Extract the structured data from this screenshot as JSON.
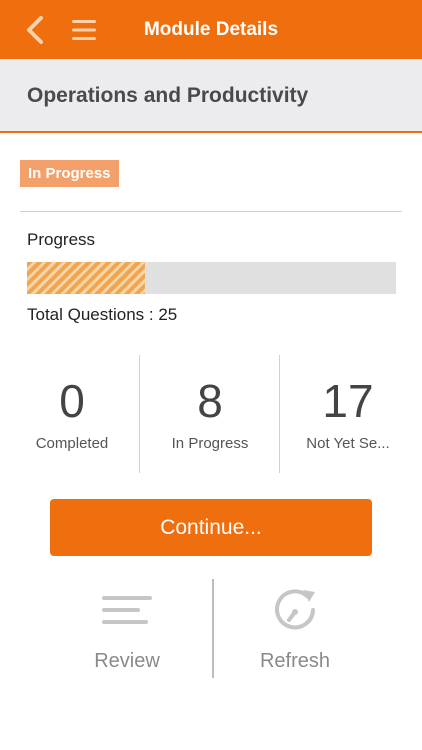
{
  "header": {
    "title": "Module Details",
    "back_icon": "chevron-left-icon",
    "menu_icon": "hamburger-menu-icon",
    "bar_color": "#ef6f0f"
  },
  "module": {
    "title": "Operations and Productivity"
  },
  "status": {
    "label": "In Progress",
    "color": "#f3a06a"
  },
  "progress": {
    "label": "Progress",
    "fraction": 0.32,
    "total_text": "Total Questions : 25"
  },
  "stats": [
    {
      "value": "0",
      "label": "Completed"
    },
    {
      "value": "8",
      "label": "In Progress"
    },
    {
      "value": "17",
      "label": "Not Yet Se..."
    }
  ],
  "actions": {
    "continue_label": "Continue...",
    "review_label": "Review",
    "review_icon": "lines-icon",
    "refresh_label": "Refresh",
    "refresh_icon": "refresh-clock-icon"
  }
}
